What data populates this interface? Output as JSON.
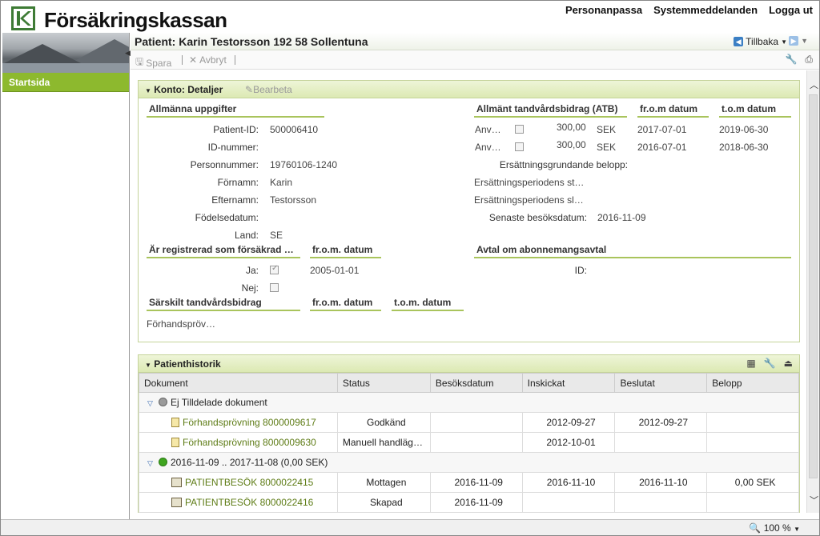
{
  "header": {
    "brand": "Försäkringskassan",
    "links": [
      "Personanpassa",
      "Systemmeddelanden",
      "Logga ut"
    ]
  },
  "sidebar": {
    "items": [
      {
        "label": "Startsida"
      }
    ]
  },
  "patient_bar": {
    "title": "Patient: Karin Testorsson 192 58 Sollentuna",
    "back_label": "Tillbaka"
  },
  "toolbar": {
    "save_label": "Spara",
    "cancel_label": "Avbryt"
  },
  "account_panel": {
    "title": "Konto: Detaljer",
    "edit_label": "Bearbeta",
    "general": {
      "heading": "Allmänna uppgifter",
      "fields": [
        {
          "label": "Patient-ID:",
          "value": "500006410"
        },
        {
          "label": "ID-nummer:",
          "value": ""
        },
        {
          "label": "Personnummer:",
          "value": "19760106-1240"
        },
        {
          "label": "Förnamn:",
          "value": "Karin"
        },
        {
          "label": "Efternamn:",
          "value": "Testorsson"
        },
        {
          "label": "Födelsedatum:",
          "value": ""
        },
        {
          "label": "Land:",
          "value": "SE"
        }
      ]
    },
    "atb": {
      "heading": "Allmänt tandvårdsbidrag (ATB)",
      "from_heading": "fr.o.m datum",
      "to_heading": "t.o.m datum",
      "rows": [
        {
          "label": "Anv…",
          "checked": false,
          "amount": "300,00",
          "currency": "SEK",
          "from": "2017-07-01",
          "to": "2019-06-30"
        },
        {
          "label": "Anv…",
          "checked": false,
          "amount": "300,00",
          "currency": "SEK",
          "from": "2016-07-01",
          "to": "2018-06-30"
        }
      ],
      "extra": [
        {
          "label": "Ersättningsgrundande belopp:",
          "value": ""
        },
        {
          "label": "Ersättningsperiodens st…",
          "value": ""
        },
        {
          "label": "Ersättningsperiodens sl…",
          "value": ""
        },
        {
          "label": "Senaste besöksdatum:",
          "value": "2016-11-09"
        }
      ]
    },
    "insurance": {
      "heading": "Är registrerad som försäkrad …",
      "from_heading": "fr.o.m. datum",
      "yes_label": "Ja:",
      "yes_checked": true,
      "yes_date": "2005-01-01",
      "no_label": "Nej:",
      "no_checked": false
    },
    "subscription": {
      "heading": "Avtal om abonnemangsavtal",
      "id_label": "ID:",
      "id_value": ""
    },
    "special": {
      "heading": "Särskilt tandvårdsbidrag",
      "from_heading": "fr.o.m. datum",
      "to_heading": "t.o.m. datum",
      "value": "Förhandspröv…"
    }
  },
  "history_panel": {
    "title": "Patienthistorik",
    "columns": [
      "Dokument",
      "Status",
      "Besöksdatum",
      "Inskickat",
      "Beslutat",
      "Belopp"
    ],
    "groups": [
      {
        "label": "Ej Tilldelade dokument",
        "dot_color": "#9a9a9a",
        "rows": [
          {
            "icon": "document-icon",
            "doc": "Förhandsprövning 8000009617",
            "status": "Godkänd",
            "visit": "",
            "sent": "2012-09-27",
            "decided": "2012-09-27",
            "amount": ""
          },
          {
            "icon": "document-icon",
            "doc": "Förhandsprövning 8000009630",
            "status": "Manuell handläg…",
            "visit": "",
            "sent": "2012-10-01",
            "decided": "",
            "amount": ""
          }
        ]
      },
      {
        "label": "2016-11-09 .. 2017-11-08 (0,00 SEK)",
        "dot_color": "#3fa51f",
        "rows": [
          {
            "icon": "visit-icon",
            "doc": "PATIENTBESÖK 8000022415",
            "status": "Mottagen",
            "visit": "2016-11-09",
            "sent": "2016-11-10",
            "decided": "2016-11-10",
            "amount": "0,00 SEK"
          },
          {
            "icon": "visit-icon",
            "doc": "PATIENTBESÖK 8000022416",
            "status": "Skapad",
            "visit": "2016-11-09",
            "sent": "",
            "decided": "",
            "amount": ""
          }
        ]
      }
    ]
  },
  "statusbar": {
    "zoom": "100 %"
  },
  "colors": {
    "brand_green": "#3e7b35",
    "nav_green": "#8db92e",
    "link_green": "#5e7c16",
    "panel_header": "#dce9b3"
  }
}
